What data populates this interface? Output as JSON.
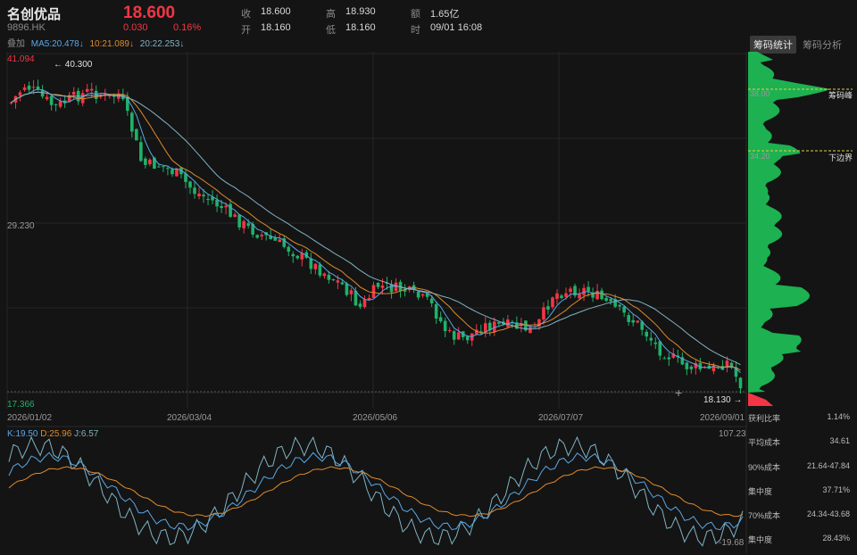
{
  "header": {
    "name": "名创优品",
    "code": "9896.HK",
    "price": "18.600",
    "change": "0.030",
    "change_pct": "0.16%",
    "quote": [
      {
        "label": "收",
        "value": "18.600"
      },
      {
        "label": "开",
        "value": "18.160"
      },
      {
        "label": "高",
        "value": "18.930"
      },
      {
        "label": "低",
        "value": "18.160"
      },
      {
        "label": "额",
        "value": "1.65亿"
      },
      {
        "label": "时",
        "value": "09/01 16:08"
      }
    ]
  },
  "ma": {
    "overlay": "叠加",
    "ma5": "MA5:20.478↓",
    "ma10": "10:21.089↓",
    "ma20": "20:22.253↓"
  },
  "tabs": {
    "active": "筹码统计",
    "other": "筹码分析"
  },
  "price_axis": {
    "top": "41.094",
    "mid": "29.230",
    "bottom": "17.366",
    "max_marker": "40.300",
    "min_marker": "18.130"
  },
  "dates": [
    "2026/01/02",
    "2026/03/04",
    "2026/05/06",
    "2026/07/07",
    "2026/09/01"
  ],
  "kdj": {
    "k": "K:19.50",
    "d": "D:25.96",
    "j": "J:6.57",
    "top": "107.23",
    "bottom": "-19.68"
  },
  "chips": {
    "peak_label": "筹码峰",
    "peak_value": "38.00",
    "lower_label": "下边界",
    "lower_value": "34.20"
  },
  "stats": [
    {
      "label": "获利比率",
      "value": "1.14%"
    },
    {
      "label": "平均成本",
      "value": "34.61"
    },
    {
      "label": "90%成本",
      "value": "21.64-47.84"
    },
    {
      "label": "集中度",
      "value": "37.71%"
    },
    {
      "label": "70%成本",
      "value": "24.34-43.68"
    },
    {
      "label": "集中度",
      "value": "28.43%"
    }
  ],
  "colors": {
    "up": "#f23645",
    "down": "#1fb26a",
    "ma5": "#5aa7e6",
    "ma10": "#e08a2c",
    "ma20": "#7fb3c4",
    "chip": "#1db954"
  }
}
